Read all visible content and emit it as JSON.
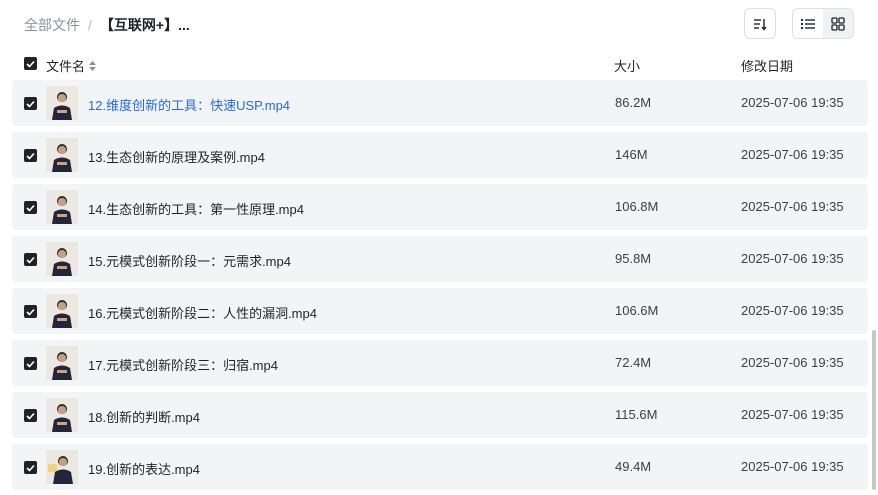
{
  "breadcrumb": {
    "root": "全部文件",
    "separator": "/",
    "current": "【互联网+】..."
  },
  "toolbar": {
    "sort_icon": "sort-icon",
    "list_view_icon": "list-view-icon",
    "grid_view_icon": "grid-view-icon"
  },
  "table": {
    "headers": {
      "name": "文件名",
      "size": "大小",
      "modified": "修改日期"
    },
    "rows": [
      {
        "name": "12.维度创新的工具：快速USP.mp4",
        "size": "86.2M",
        "date": "2025-07-06 19:35",
        "selected": true,
        "hovered": true
      },
      {
        "name": "13.生态创新的原理及案例.mp4",
        "size": "146M",
        "date": "2025-07-06 19:35",
        "selected": true
      },
      {
        "name": "14.生态创新的工具：第一性原理.mp4",
        "size": "106.8M",
        "date": "2025-07-06 19:35",
        "selected": true
      },
      {
        "name": "15.元模式创新阶段一：元需求.mp4",
        "size": "95.8M",
        "date": "2025-07-06 19:35",
        "selected": true
      },
      {
        "name": "16.元模式创新阶段二：人性的漏洞.mp4",
        "size": "106.6M",
        "date": "2025-07-06 19:35",
        "selected": true
      },
      {
        "name": "17.元模式创新阶段三：归宿.mp4",
        "size": "72.4M",
        "date": "2025-07-06 19:35",
        "selected": true
      },
      {
        "name": "18.创新的判断.mp4",
        "size": "115.6M",
        "date": "2025-07-06 19:35",
        "selected": true
      },
      {
        "name": "19.创新的表达.mp4",
        "size": "49.4M",
        "date": "2025-07-06 19:35",
        "selected": true
      }
    ]
  },
  "colors": {
    "link": "#2468f2",
    "row_bg": "#f3f4f6",
    "checkbox": "#1f2329"
  }
}
